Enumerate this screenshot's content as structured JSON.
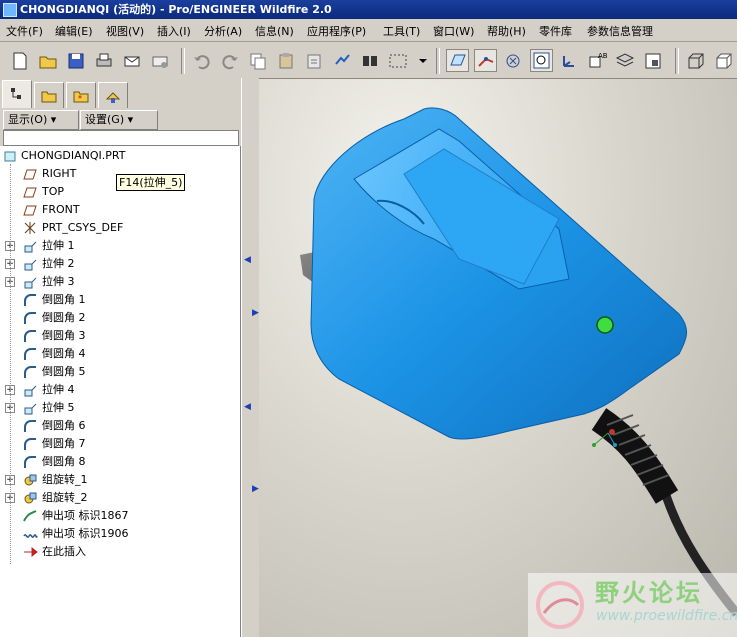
{
  "window": {
    "title": "CHONGDIANQI (活动的) - Pro/ENGINEER Wildfire 2.0"
  },
  "menu": [
    "文件(F)",
    "编辑(E)",
    "视图(V)",
    "插入(I)",
    "分析(A)",
    "信息(N)",
    "应用程序(P)",
    "工具(T)",
    "窗口(W)",
    "帮助(H)",
    "零件库",
    "参数信息管理"
  ],
  "panel": {
    "show_label": "显示(O) ▾",
    "settings_label": "设置(G) ▾"
  },
  "tree": [
    {
      "label": "CHONGDIANQI.PRT",
      "icon": "part-icon"
    },
    {
      "label": "RIGHT",
      "icon": "datum-plane-icon"
    },
    {
      "label": "TOP",
      "icon": "datum-plane-icon"
    },
    {
      "label": "FRONT",
      "icon": "datum-plane-icon"
    },
    {
      "label": "PRT_CSYS_DEF",
      "icon": "coordinate-system-icon"
    },
    {
      "label": "拉伸 1",
      "icon": "extrude-icon",
      "expand": true
    },
    {
      "label": "拉伸 2",
      "icon": "extrude-icon",
      "expand": true
    },
    {
      "label": "拉伸 3",
      "icon": "extrude-icon",
      "expand": true
    },
    {
      "label": "倒圆角 1",
      "icon": "round-icon"
    },
    {
      "label": "倒圆角 2",
      "icon": "round-icon"
    },
    {
      "label": "倒圆角 3",
      "icon": "round-icon"
    },
    {
      "label": "倒圆角 4",
      "icon": "round-icon"
    },
    {
      "label": "倒圆角 5",
      "icon": "round-icon"
    },
    {
      "label": "拉伸 4",
      "icon": "extrude-icon",
      "expand": true
    },
    {
      "label": "拉伸 5",
      "icon": "extrude-icon",
      "expand": true
    },
    {
      "label": "倒圆角 6",
      "icon": "round-icon"
    },
    {
      "label": "倒圆角 7",
      "icon": "round-icon"
    },
    {
      "label": "倒圆角 8",
      "icon": "round-icon"
    },
    {
      "label": "组旋转_1",
      "icon": "group-icon",
      "expand": true
    },
    {
      "label": "组旋转_2",
      "icon": "group-icon",
      "expand": true
    },
    {
      "label": "伸出项 标识1867",
      "icon": "sweep-icon"
    },
    {
      "label": "伸出项 标识1906",
      "icon": "helical-sweep-icon"
    },
    {
      "label": "在此插入",
      "icon": "insert-here-icon"
    }
  ],
  "tooltip": "F14(拉伸_5)",
  "watermark": {
    "text": "野火论坛",
    "url": "www.proewildfire.cn"
  },
  "colors": {
    "model": "#1e96e8",
    "led": "#3fdd3f",
    "title_bg": "#0b2a7c"
  }
}
